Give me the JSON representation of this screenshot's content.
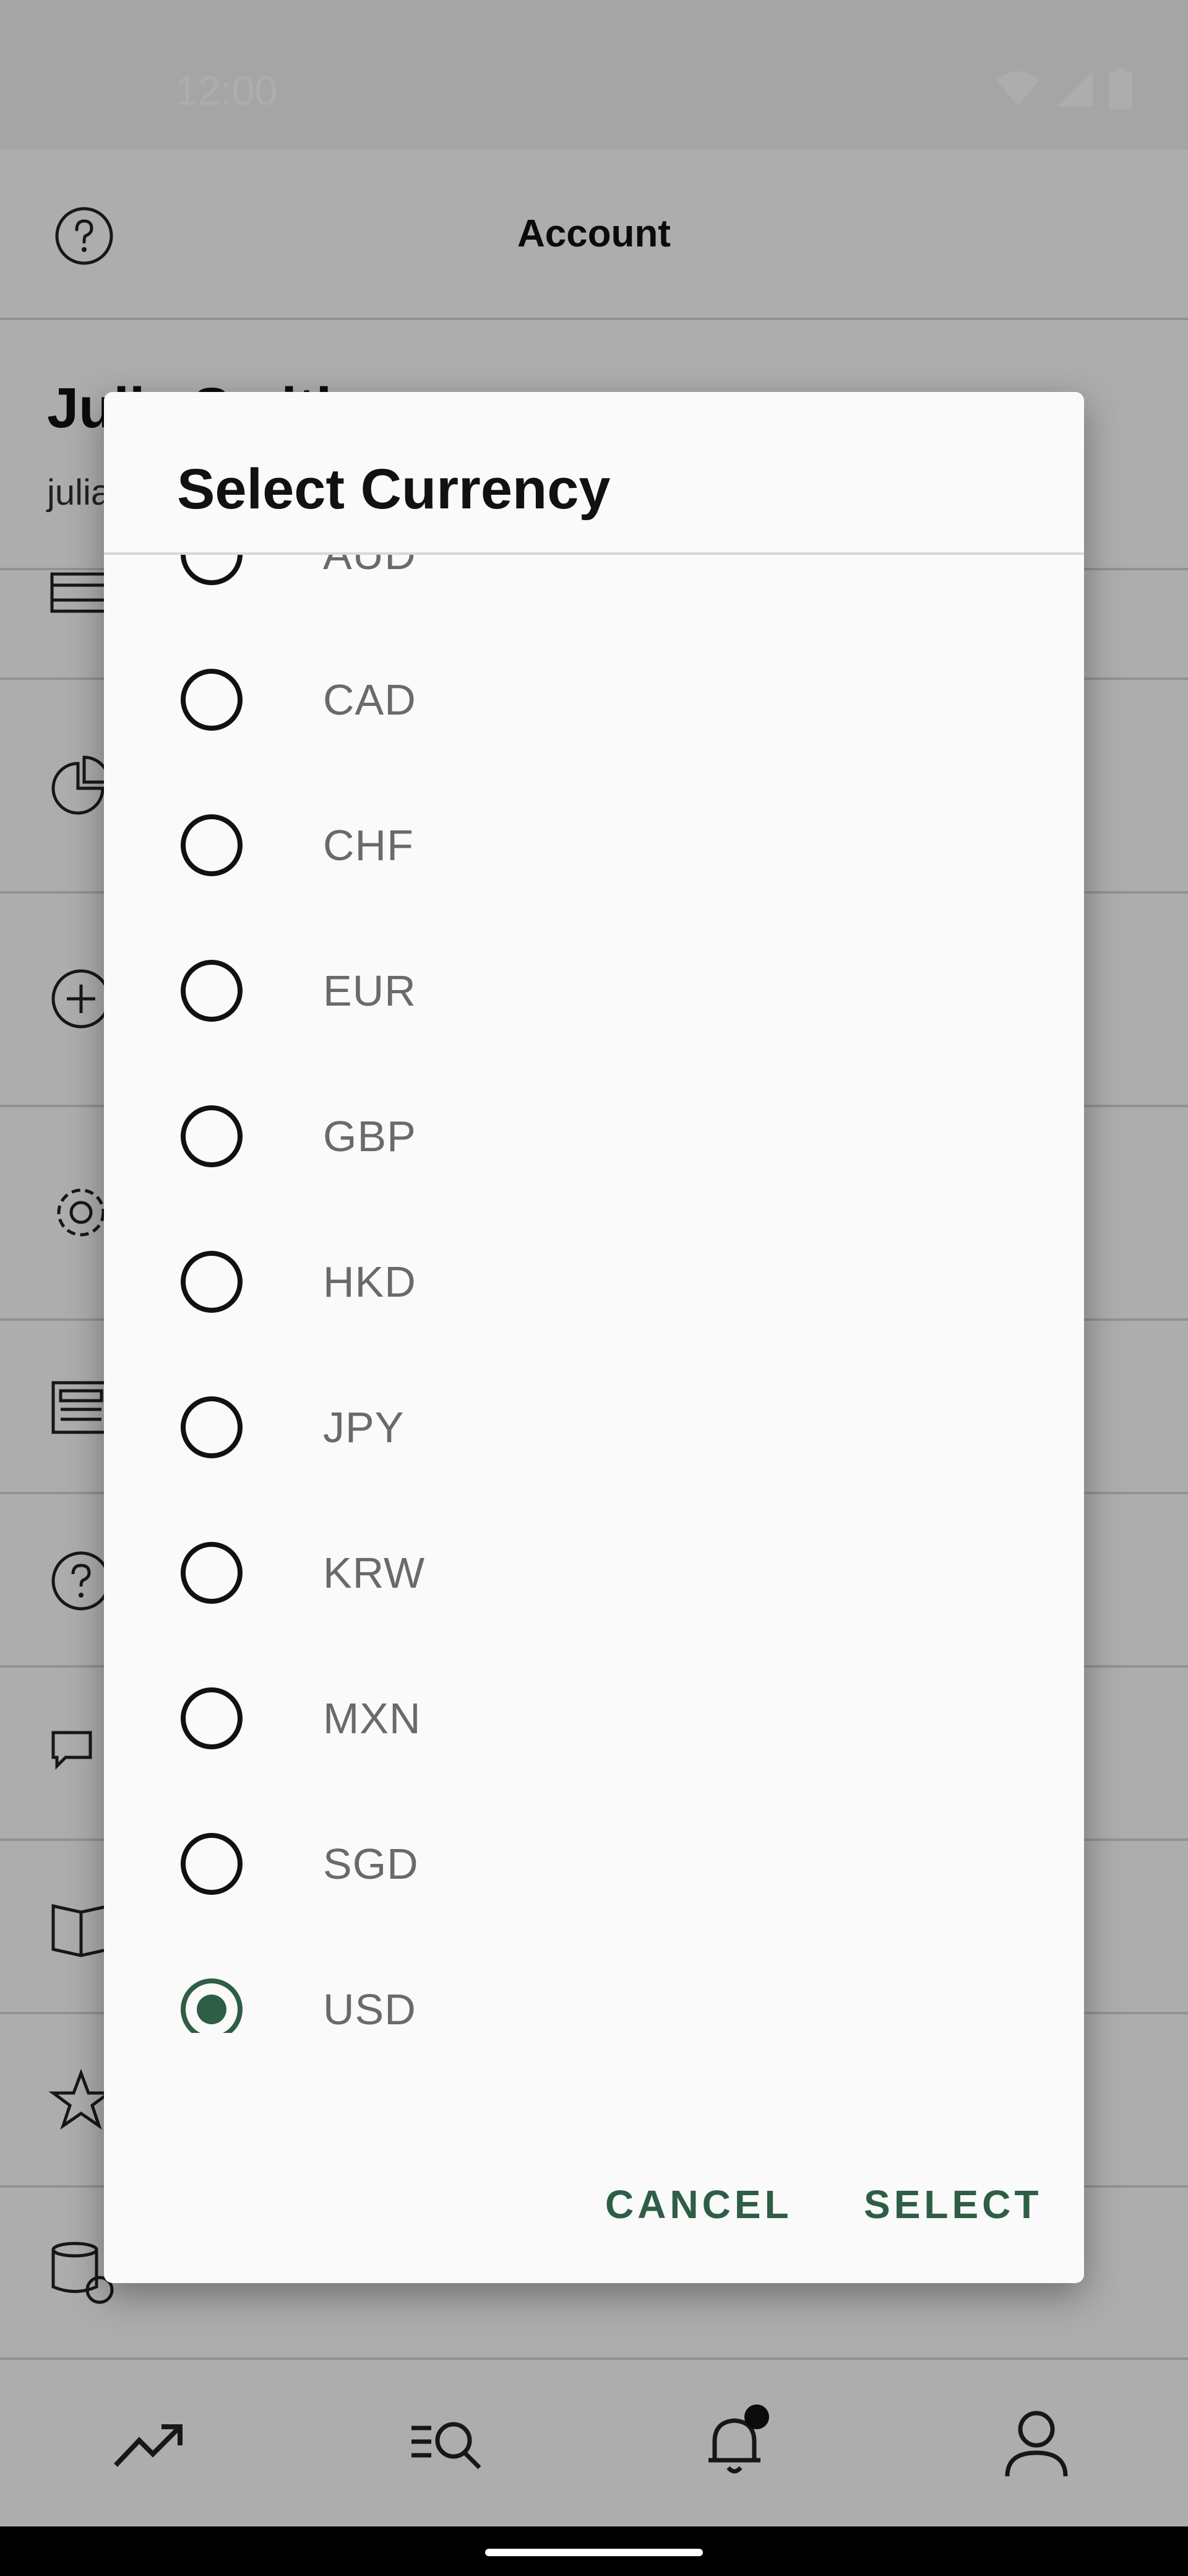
{
  "status_bar": {
    "time": "12:00",
    "icons": [
      "wifi-icon",
      "cellular-signal-icon",
      "battery-icon"
    ]
  },
  "app_bar": {
    "title": "Account",
    "help_icon": "help-circle-icon"
  },
  "profile": {
    "name": "Julia Smith",
    "email": "julia"
  },
  "menu_icons": [
    "cash-icon",
    "pie-chart-icon",
    "add-circle-icon",
    "gear-icon",
    "newspaper-icon",
    "help-circle-icon",
    "chat-icon",
    "book-icon",
    "star-icon",
    "coins-icon"
  ],
  "bottom_nav": {
    "items": [
      "trending-up-icon",
      "search-list-icon",
      "bell-icon",
      "person-icon"
    ]
  },
  "dialog": {
    "title": "Select Currency",
    "options": [
      "AUD",
      "CAD",
      "CHF",
      "EUR",
      "GBP",
      "HKD",
      "JPY",
      "KRW",
      "MXN",
      "SGD",
      "USD"
    ],
    "selected": "USD",
    "cancel_label": "CANCEL",
    "select_label": "SELECT"
  },
  "colors": {
    "accent": "#2e5e45",
    "scrim": "rgba(0,0,0,0.32)"
  }
}
